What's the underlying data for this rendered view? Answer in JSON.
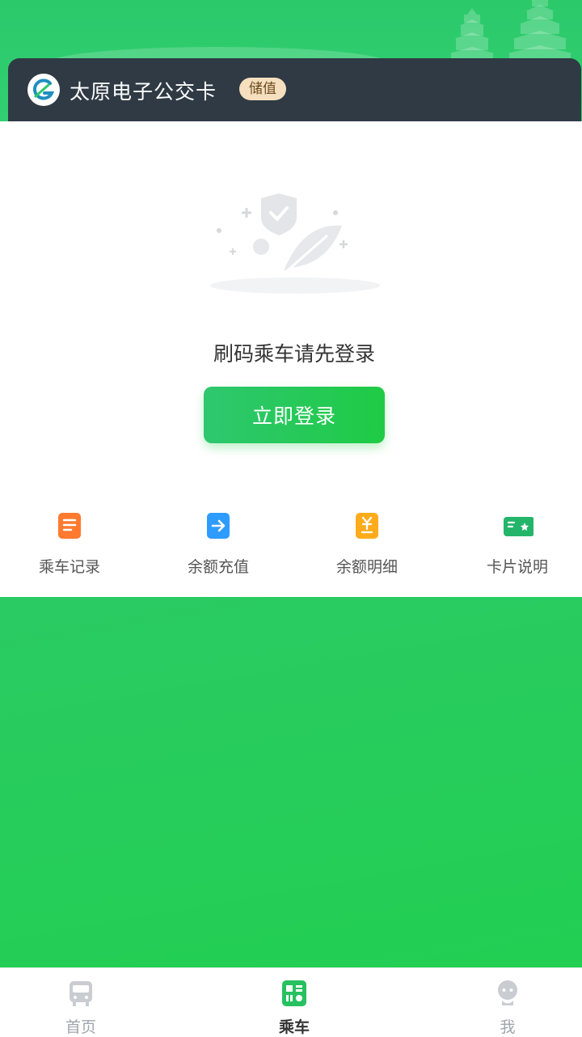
{
  "card": {
    "title": "太原电子公交卡",
    "badge": "储值",
    "logo_icon": "g-logo-icon"
  },
  "main": {
    "prompt": "刷码乘车请先登录",
    "login_button": "立即登录"
  },
  "quick_actions": [
    {
      "label": "乘车记录",
      "icon": "ride-record-icon",
      "color": "#ff7a2e"
    },
    {
      "label": "余额充值",
      "icon": "recharge-icon",
      "color": "#2e9bff"
    },
    {
      "label": "余额明细",
      "icon": "balance-detail-icon",
      "color": "#ffab1a"
    },
    {
      "label": "卡片说明",
      "icon": "card-info-icon",
      "color": "#24b56b"
    }
  ],
  "tabbar": {
    "items": [
      {
        "label": "首页",
        "icon": "bus-icon",
        "active": false
      },
      {
        "label": "乘车",
        "icon": "qr-code-icon",
        "active": true
      },
      {
        "label": "我",
        "icon": "profile-icon",
        "active": false
      }
    ]
  },
  "colors": {
    "brand_green": "#22cf52",
    "header_dark": "#2f3a44",
    "badge_bg": "#f6dfbe"
  }
}
